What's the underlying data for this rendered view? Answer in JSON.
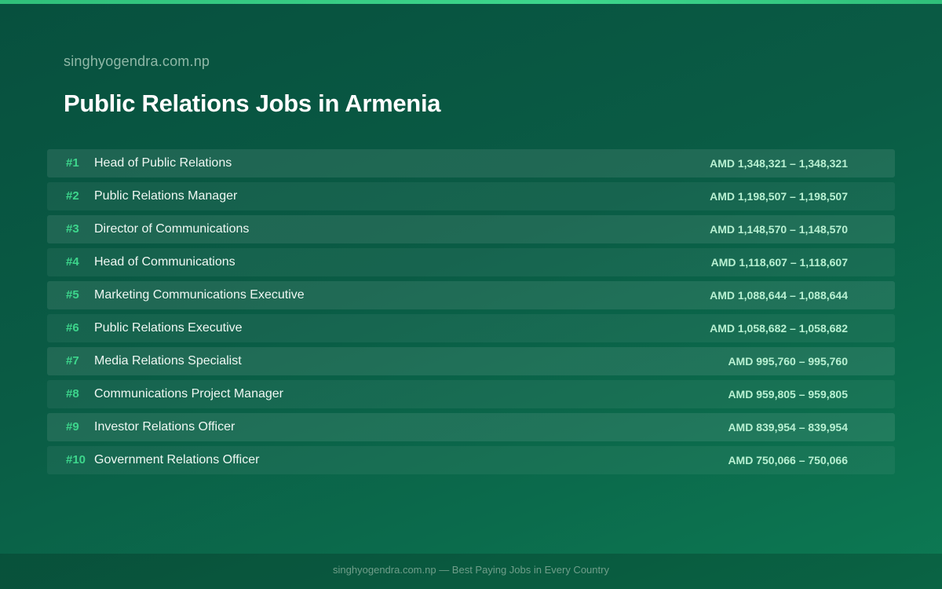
{
  "header": {
    "site_name": "singhyogendra.com.np",
    "title": "Public Relations Jobs in Armenia"
  },
  "jobs": [
    {
      "rank": "#1",
      "title": "Head of Public Relations",
      "salary": "AMD 1,348,321 – 1,348,321"
    },
    {
      "rank": "#2",
      "title": "Public Relations Manager",
      "salary": "AMD 1,198,507 – 1,198,507"
    },
    {
      "rank": "#3",
      "title": "Director of Communications",
      "salary": "AMD 1,148,570 – 1,148,570"
    },
    {
      "rank": "#4",
      "title": "Head of Communications",
      "salary": "AMD 1,118,607 – 1,118,607"
    },
    {
      "rank": "#5",
      "title": "Marketing Communications Executive",
      "salary": "AMD 1,088,644 – 1,088,644"
    },
    {
      "rank": "#6",
      "title": "Public Relations Executive",
      "salary": "AMD 1,058,682 – 1,058,682"
    },
    {
      "rank": "#7",
      "title": "Media Relations Specialist",
      "salary": "AMD 995,760 – 995,760"
    },
    {
      "rank": "#8",
      "title": "Communications Project Manager",
      "salary": "AMD 959,805 – 959,805"
    },
    {
      "rank": "#9",
      "title": "Investor Relations Officer",
      "salary": "AMD 839,954 – 839,954"
    },
    {
      "rank": "#10",
      "title": "Government Relations Officer",
      "salary": "AMD 750,066 – 750,066"
    }
  ],
  "footer": {
    "text": "singhyogendra.com.np — Best Paying Jobs in Every Country"
  },
  "colors": {
    "accent": "#3dd68c",
    "background": "#0a5c45",
    "salary": "#b8f0d2"
  }
}
